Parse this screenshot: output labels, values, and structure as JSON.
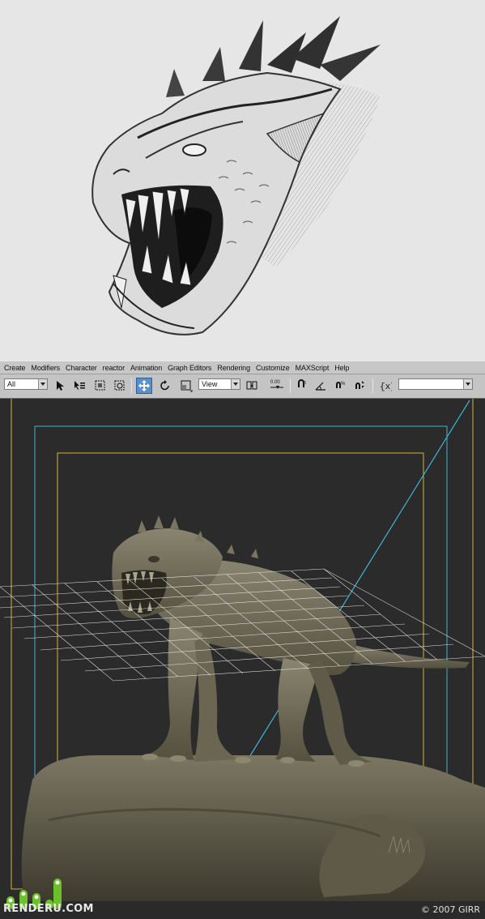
{
  "menu": {
    "items": [
      "Create",
      "Modifiers",
      "Character",
      "reactor",
      "Animation",
      "Graph Editors",
      "Rendering",
      "Customize",
      "MAXScript",
      "Help"
    ]
  },
  "toolbar": {
    "selection_filter": "All",
    "reference_coord": "View",
    "spinner_snap_value": "0.00",
    "named_selection": ""
  },
  "viewport": {
    "background": "#2b2b2b",
    "safe_frame_outer_color": "#d6b23a",
    "safe_frame_inner_color": "#3fb5d6",
    "model_color": "#6f6a55"
  },
  "footer": {
    "logo_text": "RENDERU.COM",
    "copyright": "© 2007 GIRR"
  },
  "colors": {
    "menubar": "#c7c7c7",
    "toolbar": "#c4c4c4",
    "active_tool": "#5c8fc9",
    "logo_green": "#6cc02a"
  }
}
